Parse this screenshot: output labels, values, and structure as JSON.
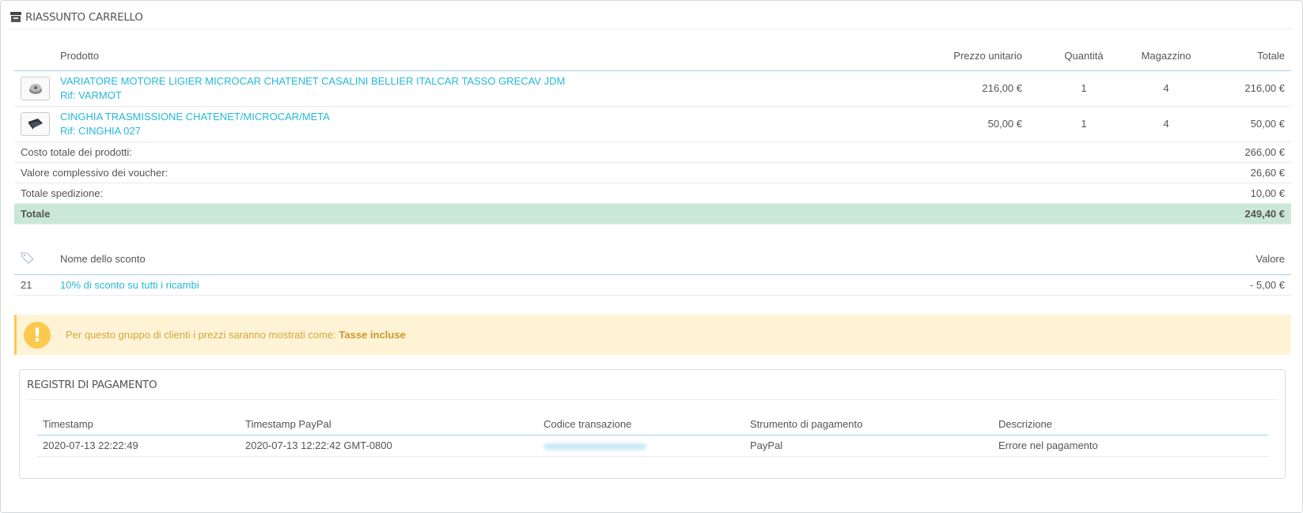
{
  "cart_summary": {
    "title": "RIASSUNTO CARRELLO",
    "headers": {
      "product": "Prodotto",
      "unit_price": "Prezzo unitario",
      "quantity": "Quantità",
      "stock": "Magazzino",
      "total": "Totale"
    },
    "products": [
      {
        "name": "VARIATORE MOTORE LIGIER MICROCAR CHATENET CASALINI BELLIER ITALCAR TASSO GRECAV JDM",
        "ref": "Rif: VARMOT",
        "unit_price": "216,00 €",
        "quantity": "1",
        "stock": "4",
        "total": "216,00 €",
        "thumb_icon": "variator-thumbnail"
      },
      {
        "name": "CINGHIA TRASMISSIONE CHATENET/MICROCAR/META",
        "ref": "Rif: CINGHIA 027",
        "unit_price": "50,00 €",
        "quantity": "1",
        "stock": "4",
        "total": "50,00 €",
        "thumb_icon": "belt-thumbnail"
      }
    ],
    "totals": {
      "products_label": "Costo totale dei prodotti:",
      "products_value": "266,00 €",
      "vouchers_label": "Valore complessivo dei voucher:",
      "vouchers_value": "26,60 €",
      "shipping_label": "Totale spedizione:",
      "shipping_value": "10,00 €",
      "grand_label": "Totale",
      "grand_value": "249,40 €"
    }
  },
  "discounts": {
    "icon": "tag-icon",
    "headers": {
      "name": "Nome dello sconto",
      "value": "Valore"
    },
    "rows": [
      {
        "id": "21",
        "name": "10% di sconto su tutti i ricambi",
        "value": "- 5,00 €"
      }
    ]
  },
  "alert": {
    "icon": "exclamation-icon",
    "text": "Per questo gruppo di clienti i prezzi saranno mostrati come: ",
    "emphasis": "Tasse incluse"
  },
  "payment_logs": {
    "title": "REGISTRI DI PAGAMENTO",
    "headers": {
      "timestamp": "Timestamp",
      "paypal_timestamp": "Timestamp PayPal",
      "transaction_code": "Codice transazione",
      "payment_method": "Strumento di pagamento",
      "description": "Descrizione"
    },
    "rows": [
      {
        "timestamp": "2020-07-13 22:22:49",
        "paypal_timestamp": "2020-07-13 12:22:42 GMT-0800",
        "payment_method": "PayPal",
        "description": "Errore nel pagamento"
      }
    ]
  },
  "colors": {
    "link": "#25b9d7",
    "total_row_bg": "#cbe8d6",
    "alert_bg": "#fff3d6",
    "alert_accent": "#fcc94f"
  }
}
